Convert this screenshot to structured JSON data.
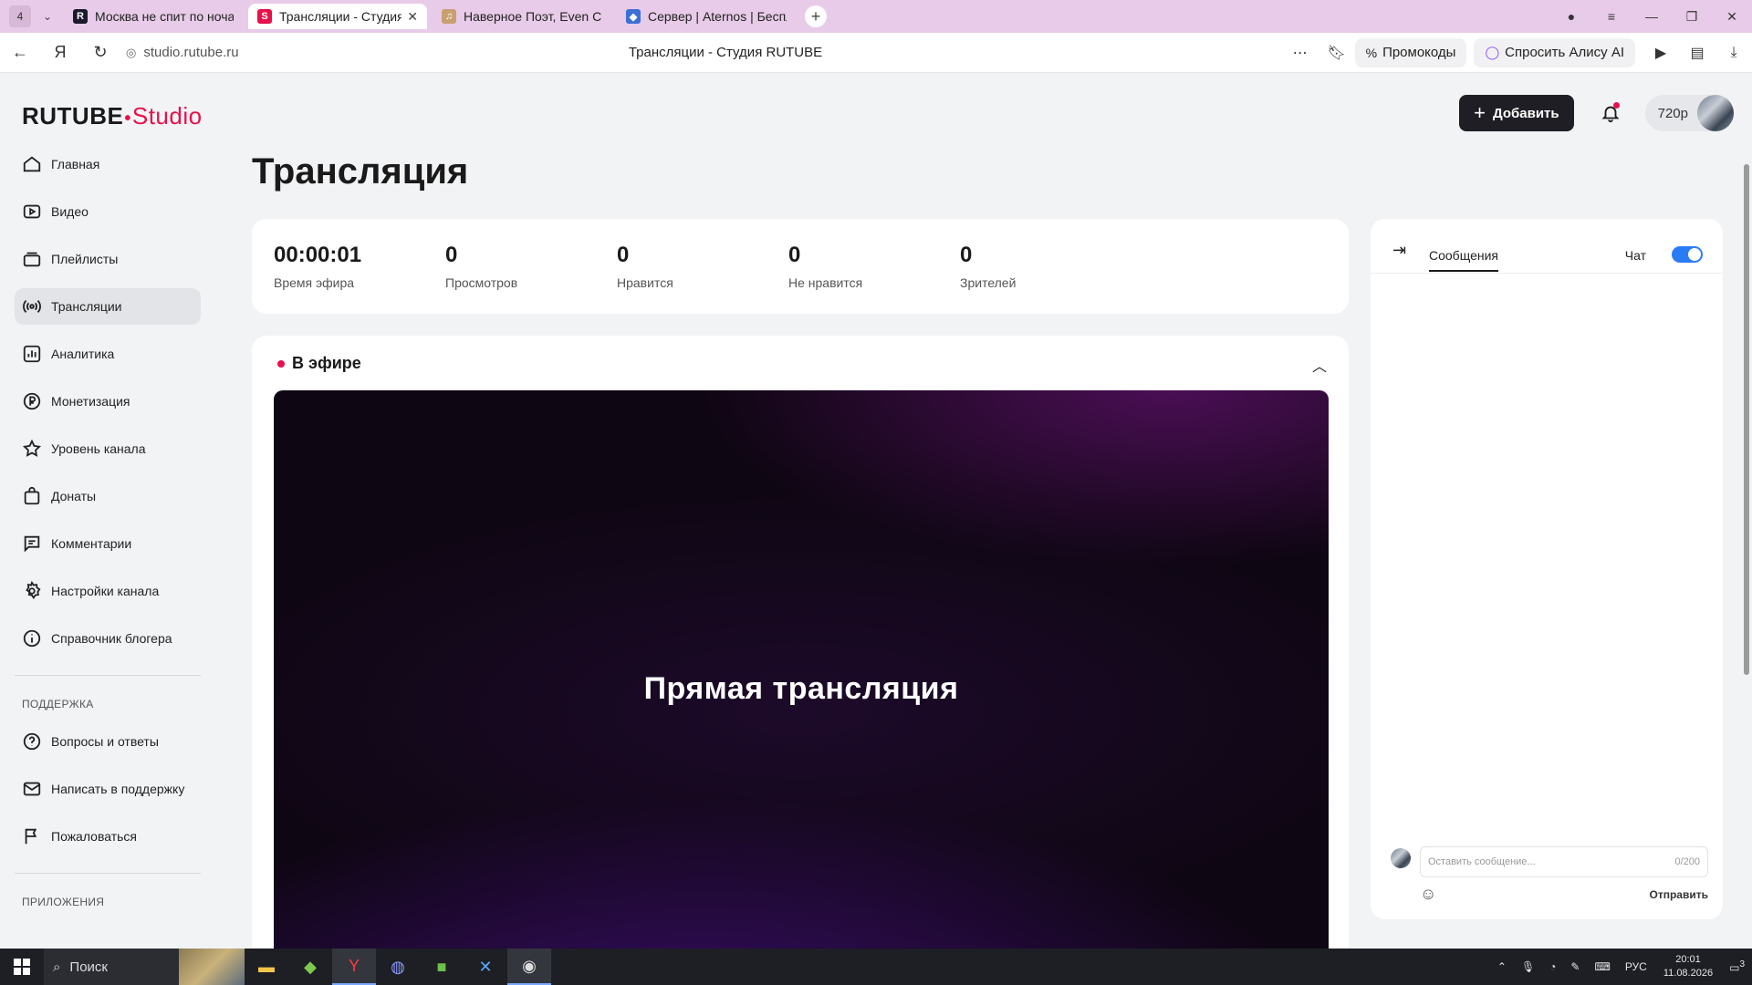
{
  "browser": {
    "tab_count": "4",
    "tabs": [
      {
        "label": "Москва не спит по ночам",
        "favicon_color": "#1a1a2e",
        "favicon_letter": "R"
      },
      {
        "label": "Трансляции - Студия RUTUBE",
        "favicon_color": "#e8104a",
        "favicon_letter": "S"
      },
      {
        "label": "Наверное Поэт, Even Cut",
        "favicon_color": "#c8a070",
        "favicon_letter": "♫"
      },
      {
        "label": "Сервер | Aternos | Беспла",
        "favicon_color": "#3b6fd6",
        "favicon_letter": "◆"
      }
    ],
    "url": "studio.rutube.ru",
    "page_title": "Трансляции - Студия RUTUBE",
    "promo_label": "Промокоды",
    "alice_label": "Спросить Алису AI"
  },
  "header": {
    "logo_main": "RUTUBE",
    "logo_sub": "Studio",
    "add_label": "Добавить",
    "quality": "720p"
  },
  "sidebar": {
    "items": [
      {
        "label": "Главная",
        "icon": "home-icon"
      },
      {
        "label": "Видео",
        "icon": "video-icon"
      },
      {
        "label": "Плейлисты",
        "icon": "playlist-icon"
      },
      {
        "label": "Трансляции",
        "icon": "broadcast-icon"
      },
      {
        "label": "Аналитика",
        "icon": "analytics-icon"
      },
      {
        "label": "Монетизация",
        "icon": "ruble-icon"
      },
      {
        "label": "Уровень канала",
        "icon": "star-icon"
      },
      {
        "label": "Донаты",
        "icon": "bag-icon"
      },
      {
        "label": "Комментарии",
        "icon": "comment-icon"
      },
      {
        "label": "Настройки канала",
        "icon": "gear-icon"
      },
      {
        "label": "Справочник блогера",
        "icon": "info-icon"
      }
    ],
    "support_header": "ПОДДЕРЖКА",
    "support_items": [
      {
        "label": "Вопросы и ответы",
        "icon": "question-icon"
      },
      {
        "label": "Написать в поддержку",
        "icon": "mail-icon"
      },
      {
        "label": "Пожаловаться",
        "icon": "flag-icon"
      }
    ],
    "apps_header": "ПРИЛОЖЕНИЯ"
  },
  "main": {
    "heading": "Трансляция",
    "stats": [
      {
        "value": "00:00:01",
        "label": "Время эфира"
      },
      {
        "value": "0",
        "label": "Просмотров"
      },
      {
        "value": "0",
        "label": "Нравится"
      },
      {
        "value": "0",
        "label": "Не нравится"
      },
      {
        "value": "0",
        "label": "Зрителей"
      }
    ],
    "live_label": "В эфире",
    "player_text": "Прямая трансляция"
  },
  "chat": {
    "tab_label": "Сообщения",
    "toggle_label": "Чат",
    "toggle_on": true,
    "input_placeholder": "Оставить сообщение...",
    "counter": "0/200",
    "send_label": "Отправить"
  },
  "taskbar": {
    "search_label": "Поиск",
    "lang": "РУС",
    "time": "20:01",
    "date": "11.08.2026",
    "notif_count": "3"
  },
  "colors": {
    "accent": "#e8104a",
    "toggle": "#2a7cf5",
    "tabbar": "#e8cbe8"
  }
}
